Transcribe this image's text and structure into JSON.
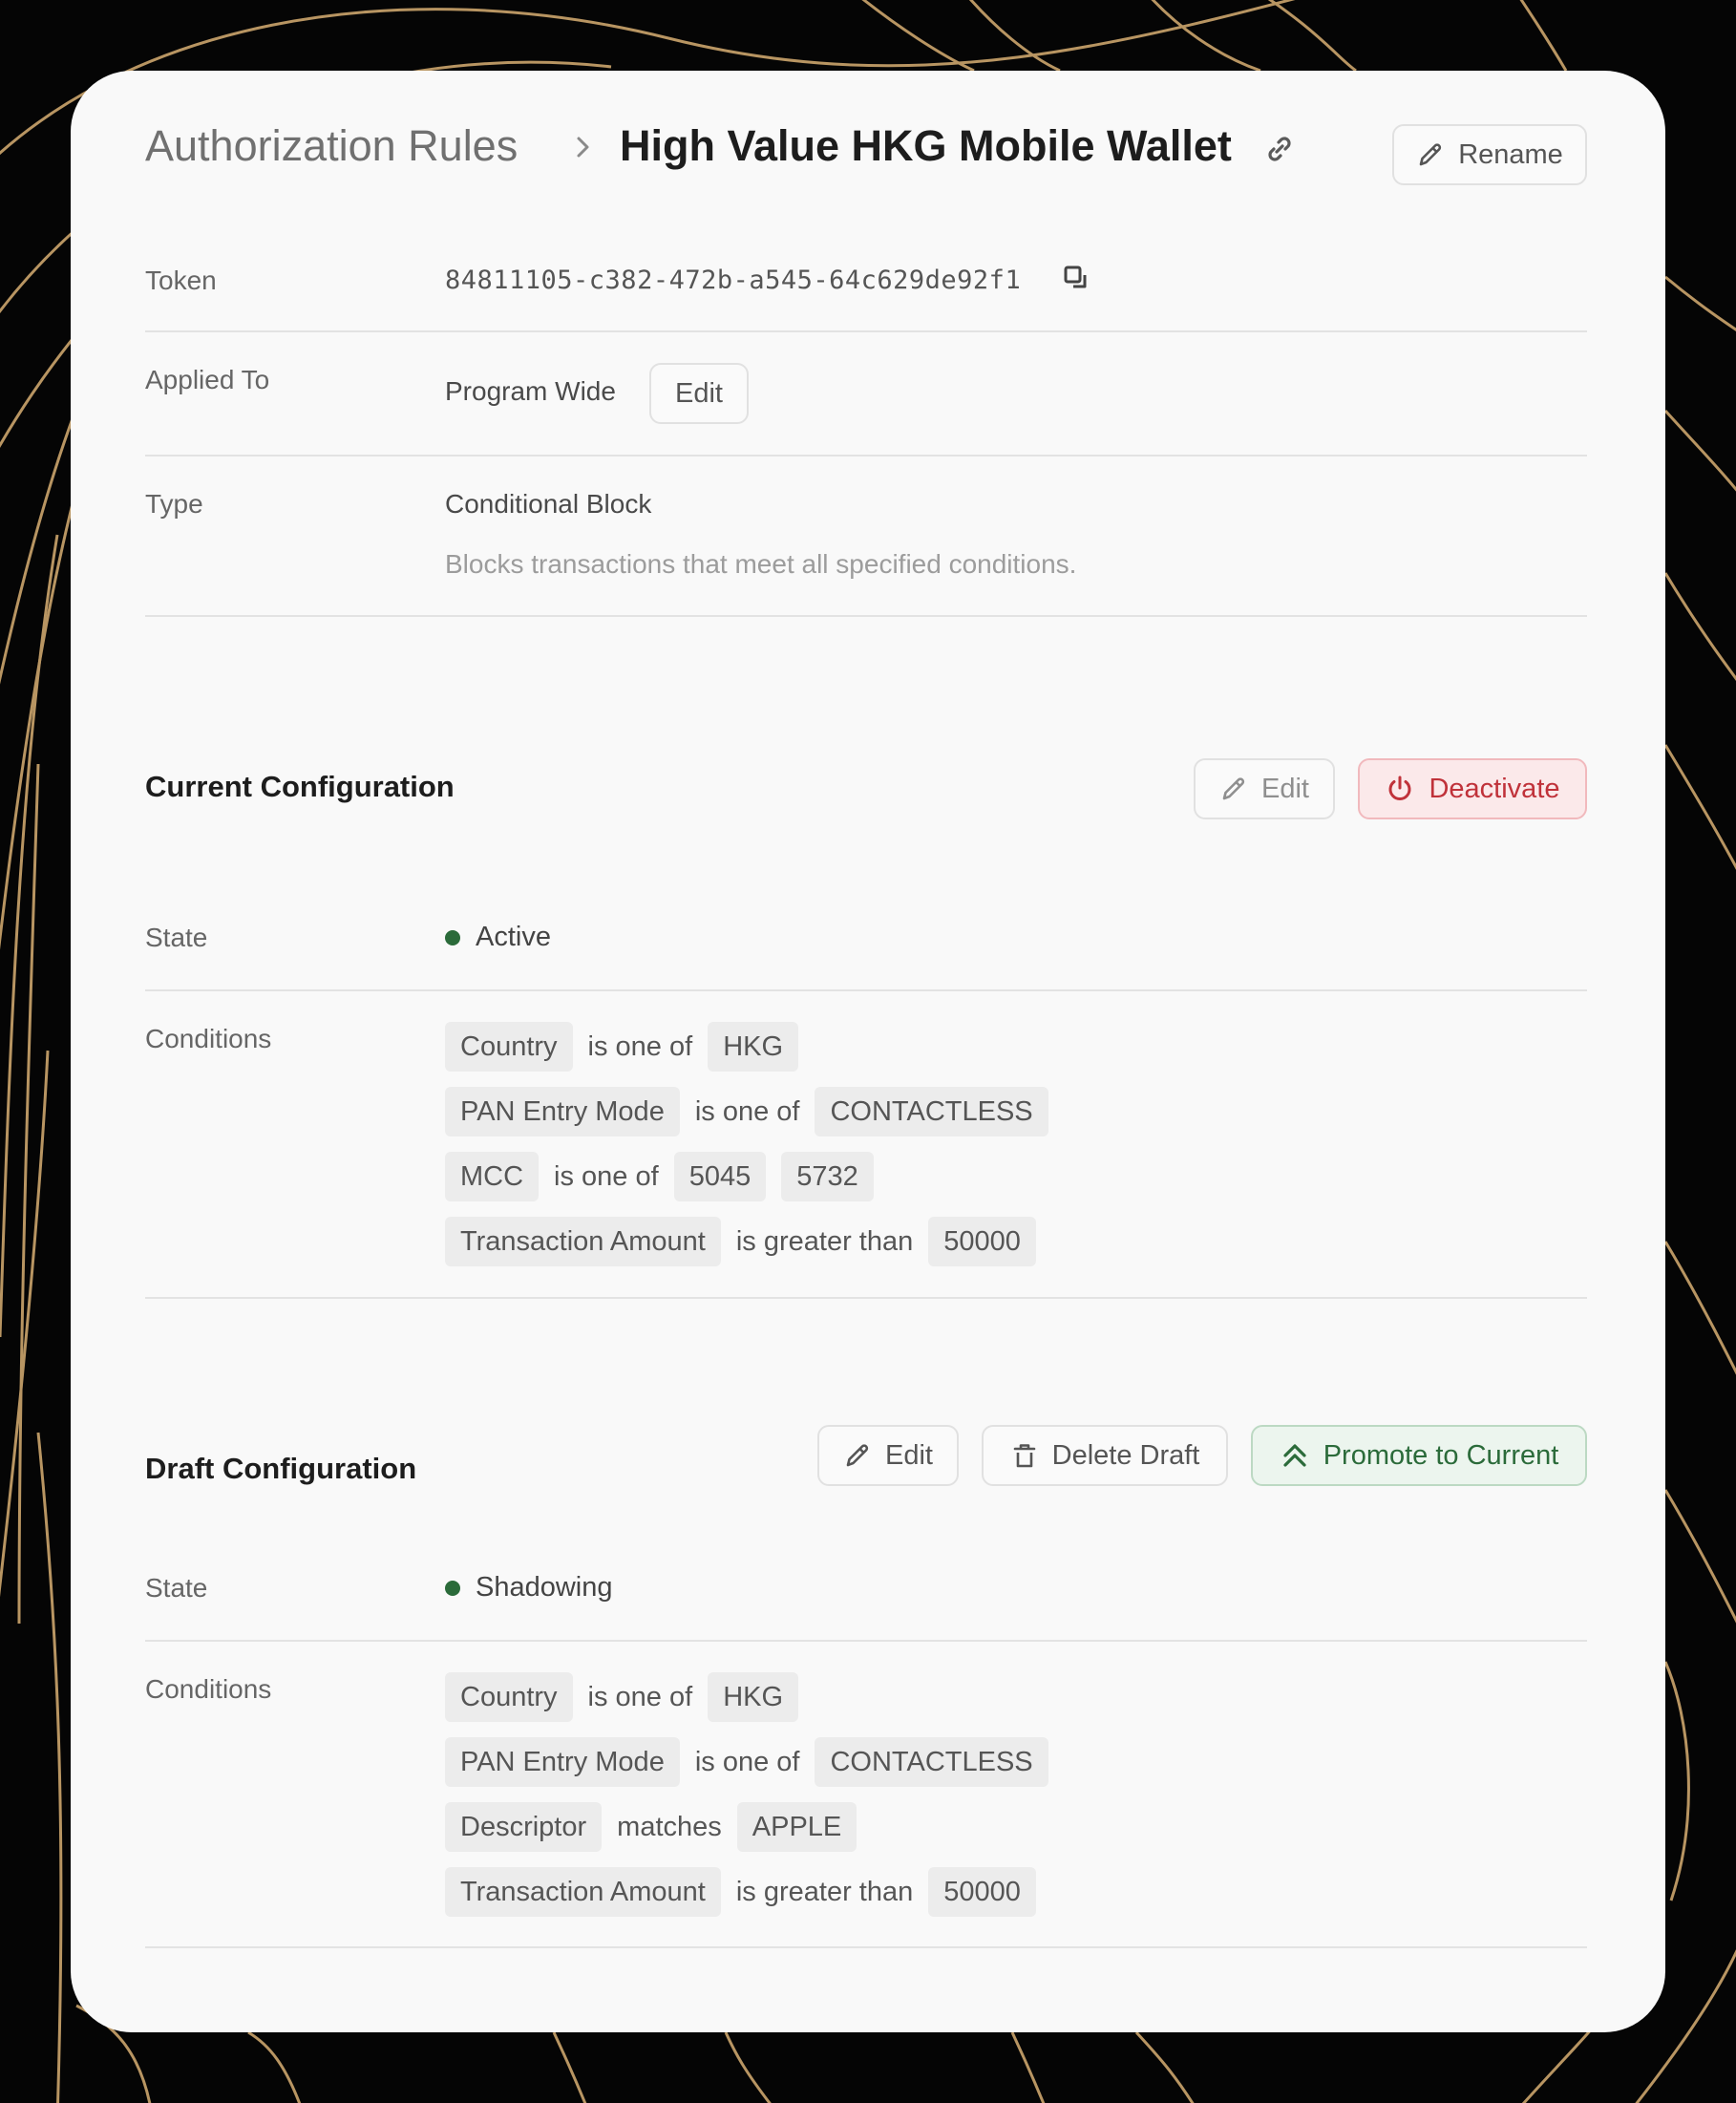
{
  "breadcrumb": {
    "parent": "Authorization Rules",
    "current": "High Value HKG Mobile Wallet"
  },
  "header": {
    "rename_label": "Rename"
  },
  "details": {
    "token": {
      "label": "Token",
      "value": "84811105-c382-472b-a545-64c629de92f1"
    },
    "applied_to": {
      "label": "Applied To",
      "value": "Program Wide",
      "edit_label": "Edit"
    },
    "type": {
      "label": "Type",
      "value": "Conditional Block",
      "description": "Blocks transactions that meet all specified conditions."
    }
  },
  "current": {
    "title": "Current Configuration",
    "edit_label": "Edit",
    "deactivate_label": "Deactivate",
    "state_label": "State",
    "state_value": "Active",
    "conditions_label": "Conditions",
    "conditions": [
      {
        "field": "Country",
        "op": "is one of",
        "values": [
          "HKG"
        ]
      },
      {
        "field": "PAN Entry Mode",
        "op": "is one of",
        "values": [
          "CONTACTLESS"
        ]
      },
      {
        "field": "MCC",
        "op": "is one of",
        "values": [
          "5045",
          "5732"
        ]
      },
      {
        "field": "Transaction Amount",
        "op": "is greater than",
        "values": [
          "50000"
        ]
      }
    ]
  },
  "draft": {
    "title": "Draft Configuration",
    "edit_label": "Edit",
    "delete_label": "Delete Draft",
    "promote_label": "Promote to Current",
    "state_label": "State",
    "state_value": "Shadowing",
    "conditions_label": "Conditions",
    "conditions": [
      {
        "field": "Country",
        "op": "is one of",
        "values": [
          "HKG"
        ]
      },
      {
        "field": "PAN Entry Mode",
        "op": "is one of",
        "values": [
          "CONTACTLESS"
        ]
      },
      {
        "field": "Descriptor",
        "op": "matches",
        "values": [
          "APPLE"
        ]
      },
      {
        "field": "Transaction Amount",
        "op": "is greater than",
        "values": [
          "50000"
        ]
      }
    ]
  },
  "colors": {
    "background": "#050505",
    "contour_lines": "#b89562",
    "card": "#f9f9f9",
    "danger": "#c0323a",
    "danger_bg": "#fbe9ea",
    "success": "#2b6b3a",
    "success_bg": "#ecf5ee",
    "state_dot": "#2b6b3a"
  },
  "icons": {
    "crumb_separator": "chevron-right-icon",
    "link": "link-icon",
    "rename": "pencil-icon",
    "copy": "copy-icon",
    "deactivate": "power-icon",
    "delete": "trash-icon",
    "promote": "double-chevron-up-icon"
  }
}
